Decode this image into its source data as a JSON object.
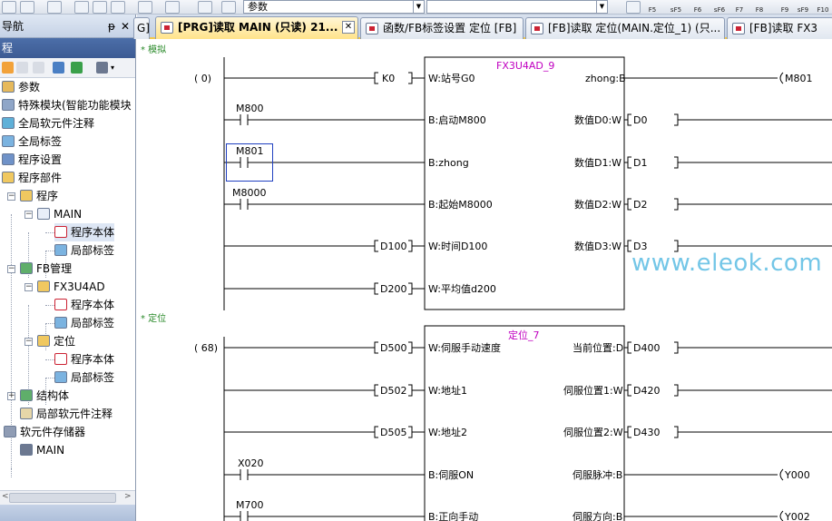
{
  "toolbar": {
    "combo_value": "参数",
    "fkeys": [
      "F5",
      "sF5",
      "F6",
      "sF6",
      "F7",
      "F8",
      "F9",
      "sF9",
      "F10"
    ]
  },
  "nav": {
    "header_title": "导航",
    "pin_glyph": "ᵽ",
    "close_glyph": "✕",
    "section_title": "程",
    "tree": [
      {
        "label": "参数"
      },
      {
        "label": "特殊模块(智能功能模块"
      },
      {
        "label": "全局软元件注释"
      },
      {
        "label": "全局标签"
      },
      {
        "label": "程序设置"
      },
      {
        "label": "程序部件"
      },
      {
        "label": "程序"
      },
      {
        "label": "MAIN"
      },
      {
        "label": "程序本体"
      },
      {
        "label": "局部标签"
      },
      {
        "label": "FB管理"
      },
      {
        "label": "FX3U4AD"
      },
      {
        "label": "程序本体"
      },
      {
        "label": "局部标签"
      },
      {
        "label": "定位"
      },
      {
        "label": "程序本体"
      },
      {
        "label": "局部标签"
      },
      {
        "label": "结构体"
      },
      {
        "label": "局部软元件注释"
      },
      {
        "label": "软元件存储器"
      },
      {
        "label": "MAIN"
      }
    ]
  },
  "tabs": [
    {
      "label": "G]"
    },
    {
      "label": "[PRG]读取 MAIN (只读) 21..."
    },
    {
      "label": "函数/FB标签设置 定位 [FB]"
    },
    {
      "label": "[FB]读取 定位(MAIN.定位_1) (只..."
    },
    {
      "label": "[FB]读取 FX3"
    }
  ],
  "ladder": {
    "rung1": {
      "comment": "* 模拟",
      "step": "(     0)",
      "fb_name": "FX3U4AD_9",
      "contacts": [
        "M800",
        "M801",
        "M8000"
      ],
      "inputs": [
        {
          "var": "K0",
          "port": "W:站号G0"
        },
        {
          "var": "",
          "port": "B:启动M800"
        },
        {
          "var": "",
          "port": "B:zhong"
        },
        {
          "var": "",
          "port": "B:起始M8000"
        },
        {
          "var": "D100",
          "port": "W:时间D100"
        },
        {
          "var": "D200",
          "port": "W:平均值d200"
        }
      ],
      "outputs": [
        {
          "port": "zhong:B",
          "var": "M801"
        },
        {
          "port": "数值D0:W",
          "var": "D0"
        },
        {
          "port": "数值D1:W",
          "var": "D1"
        },
        {
          "port": "数值D2:W",
          "var": "D2"
        },
        {
          "port": "数值D3:W",
          "var": "D3"
        }
      ]
    },
    "rung2": {
      "comment": "* 定位",
      "step": "(    68)",
      "fb_name": "定位_7",
      "contacts": [
        "X020",
        "M700"
      ],
      "inputs": [
        {
          "var": "D500",
          "port": "W:伺服手动速度"
        },
        {
          "var": "D502",
          "port": "W:地址1"
        },
        {
          "var": "D505",
          "port": "W:地址2"
        },
        {
          "var": "",
          "port": "B:伺服ON"
        },
        {
          "var": "",
          "port": "B:正向手动"
        }
      ],
      "outputs": [
        {
          "port": "当前位置:D",
          "var": "D400"
        },
        {
          "port": "伺服位置1:W",
          "var": "D420"
        },
        {
          "port": "伺服位置2:W",
          "var": "D430"
        },
        {
          "port": "伺服脉冲:B",
          "var": "Y000"
        },
        {
          "port": "伺服方向:B",
          "var": "Y002"
        }
      ]
    }
  },
  "watermark": "www.eleok.com"
}
